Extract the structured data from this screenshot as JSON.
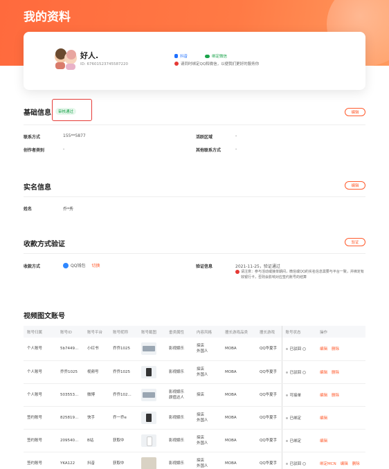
{
  "header": {
    "title": "我的资料"
  },
  "profile": {
    "name": "好人.",
    "id_text": "ID: 67601523745587220",
    "bind_douyin": "抖音",
    "bind_wechat": "绑定微信",
    "tip": "请同时绑定QQ和微信，以便我们更好的服务你"
  },
  "basic": {
    "title": "基础信息",
    "status": "审核通过",
    "edit": "编辑",
    "contact_label": "联系方式",
    "contact_value": "155**5877",
    "region_label": "活跃区域",
    "region_value": "-",
    "creator_label": "创作者类别",
    "creator_value": "-",
    "other_label": "其他联系方式",
    "other_value": "-"
  },
  "realname": {
    "title": "实名信息",
    "edit": "编辑",
    "name_label": "姓名",
    "name_value": "乔*秀"
  },
  "payment": {
    "title": "收款方式验证",
    "verify_btn": "验证",
    "method_label": "收款方式",
    "method_value": "QQ钱包",
    "switch": "切换",
    "info_label": "验证信息",
    "info_value": "2021-11-25，验证通过",
    "note": "请注意：参与活动或接单期间，微信或QQ的实名信息需要与平台一致，并绑定有效银行卡，否则会影响对应签约账号的结算"
  },
  "accounts": {
    "title": "视频图文账号",
    "headers": [
      "账号归属",
      "账号ID",
      "账号平台",
      "账号昵称",
      "账号截图",
      "垂类属性",
      "内容风格",
      "擅长游戏品类",
      "擅长游戏",
      "账号状态",
      "操作"
    ],
    "rows": [
      {
        "owner": "个人账号",
        "id": "5b7449...",
        "platform": "小红书",
        "nickname": "乔乔1025",
        "vertical": "影视娱乐",
        "style": "探店\n外国人",
        "genre": "MOBA",
        "game": "QQ华夏手",
        "status": "已驳回",
        "actions": [
          "编辑",
          "删除"
        ]
      },
      {
        "owner": "个人账号",
        "id": "乔乔1025",
        "platform": "视频号",
        "nickname": "乔乔1025",
        "vertical": "影视娱乐",
        "style": "探店\n外国人",
        "genre": "MOBA",
        "game": "QQ华夏手",
        "status": "已驳回",
        "actions": [
          "编辑",
          "删除"
        ]
      },
      {
        "owner": "个人账号",
        "id": "503553...",
        "platform": "微博",
        "nickname": "乔乔102...",
        "vertical": "影视娱乐\n颜值达人",
        "style": "探店",
        "genre": "MOBA",
        "game": "QQ华夏手",
        "status": "可接单",
        "actions": [
          "编辑",
          "删除"
        ]
      },
      {
        "owner": "签约账号",
        "id": "825819...",
        "platform": "快手",
        "nickname": "乔一乔e",
        "vertical": "影视娱乐",
        "style": "探店\n外国人",
        "genre": "MOBA",
        "game": "QQ华夏手",
        "status": "已绑定",
        "actions": [
          "编辑"
        ]
      },
      {
        "owner": "签约账号",
        "id": "209540...",
        "platform": "B站",
        "nickname": "获取中",
        "vertical": "影视娱乐",
        "style": "探店\n外国人",
        "genre": "MOBA",
        "game": "QQ华夏手",
        "status": "已绑定",
        "actions": [
          "编辑"
        ]
      },
      {
        "owner": "签约账号",
        "id": "YKA122",
        "platform": "抖音",
        "nickname": "获取中",
        "vertical": "影视娱乐",
        "style": "探店\n外国人",
        "genre": "MOBA",
        "game": "QQ华夏手",
        "status": "已驳回",
        "actions": [
          "绑定MCN",
          "编辑",
          "删除"
        ]
      }
    ]
  },
  "colors": {
    "brand": "#ff5a2c",
    "hero": "#ff6a3d",
    "success": "#1aa34a",
    "danger": "#e53935"
  },
  "icons": [
    "douyin-icon",
    "wechat-icon",
    "alert-icon",
    "qq-wallet-icon",
    "info-icon"
  ]
}
